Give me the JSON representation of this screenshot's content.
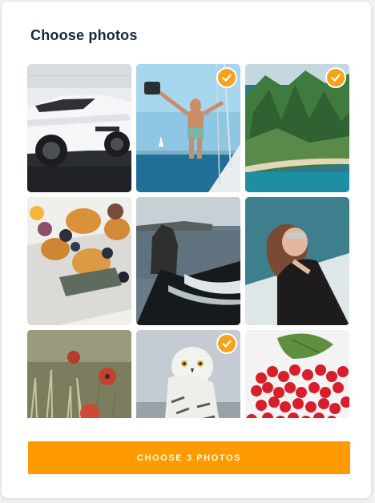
{
  "dialog": {
    "title": "Choose photos"
  },
  "photos": [
    {
      "subject": "white sports car",
      "selected": false
    },
    {
      "subject": "man on sailboat",
      "selected": true
    },
    {
      "subject": "green coastal cliffs",
      "selected": true
    },
    {
      "subject": "croissants and figs",
      "selected": false
    },
    {
      "subject": "black sand beach sea stack",
      "selected": false
    },
    {
      "subject": "woman with sunglasses",
      "selected": false
    },
    {
      "subject": "red wildflowers",
      "selected": false
    },
    {
      "subject": "snowy owl",
      "selected": true
    },
    {
      "subject": "red currants",
      "selected": false
    }
  ],
  "action": {
    "button_label": "CHOOSE 3 PHOTOS"
  },
  "colors": {
    "accent": "#ff9a00",
    "check": "#f7a21b",
    "title": "#16263f"
  },
  "icons": {
    "selected_badge": "checkmark-icon"
  }
}
